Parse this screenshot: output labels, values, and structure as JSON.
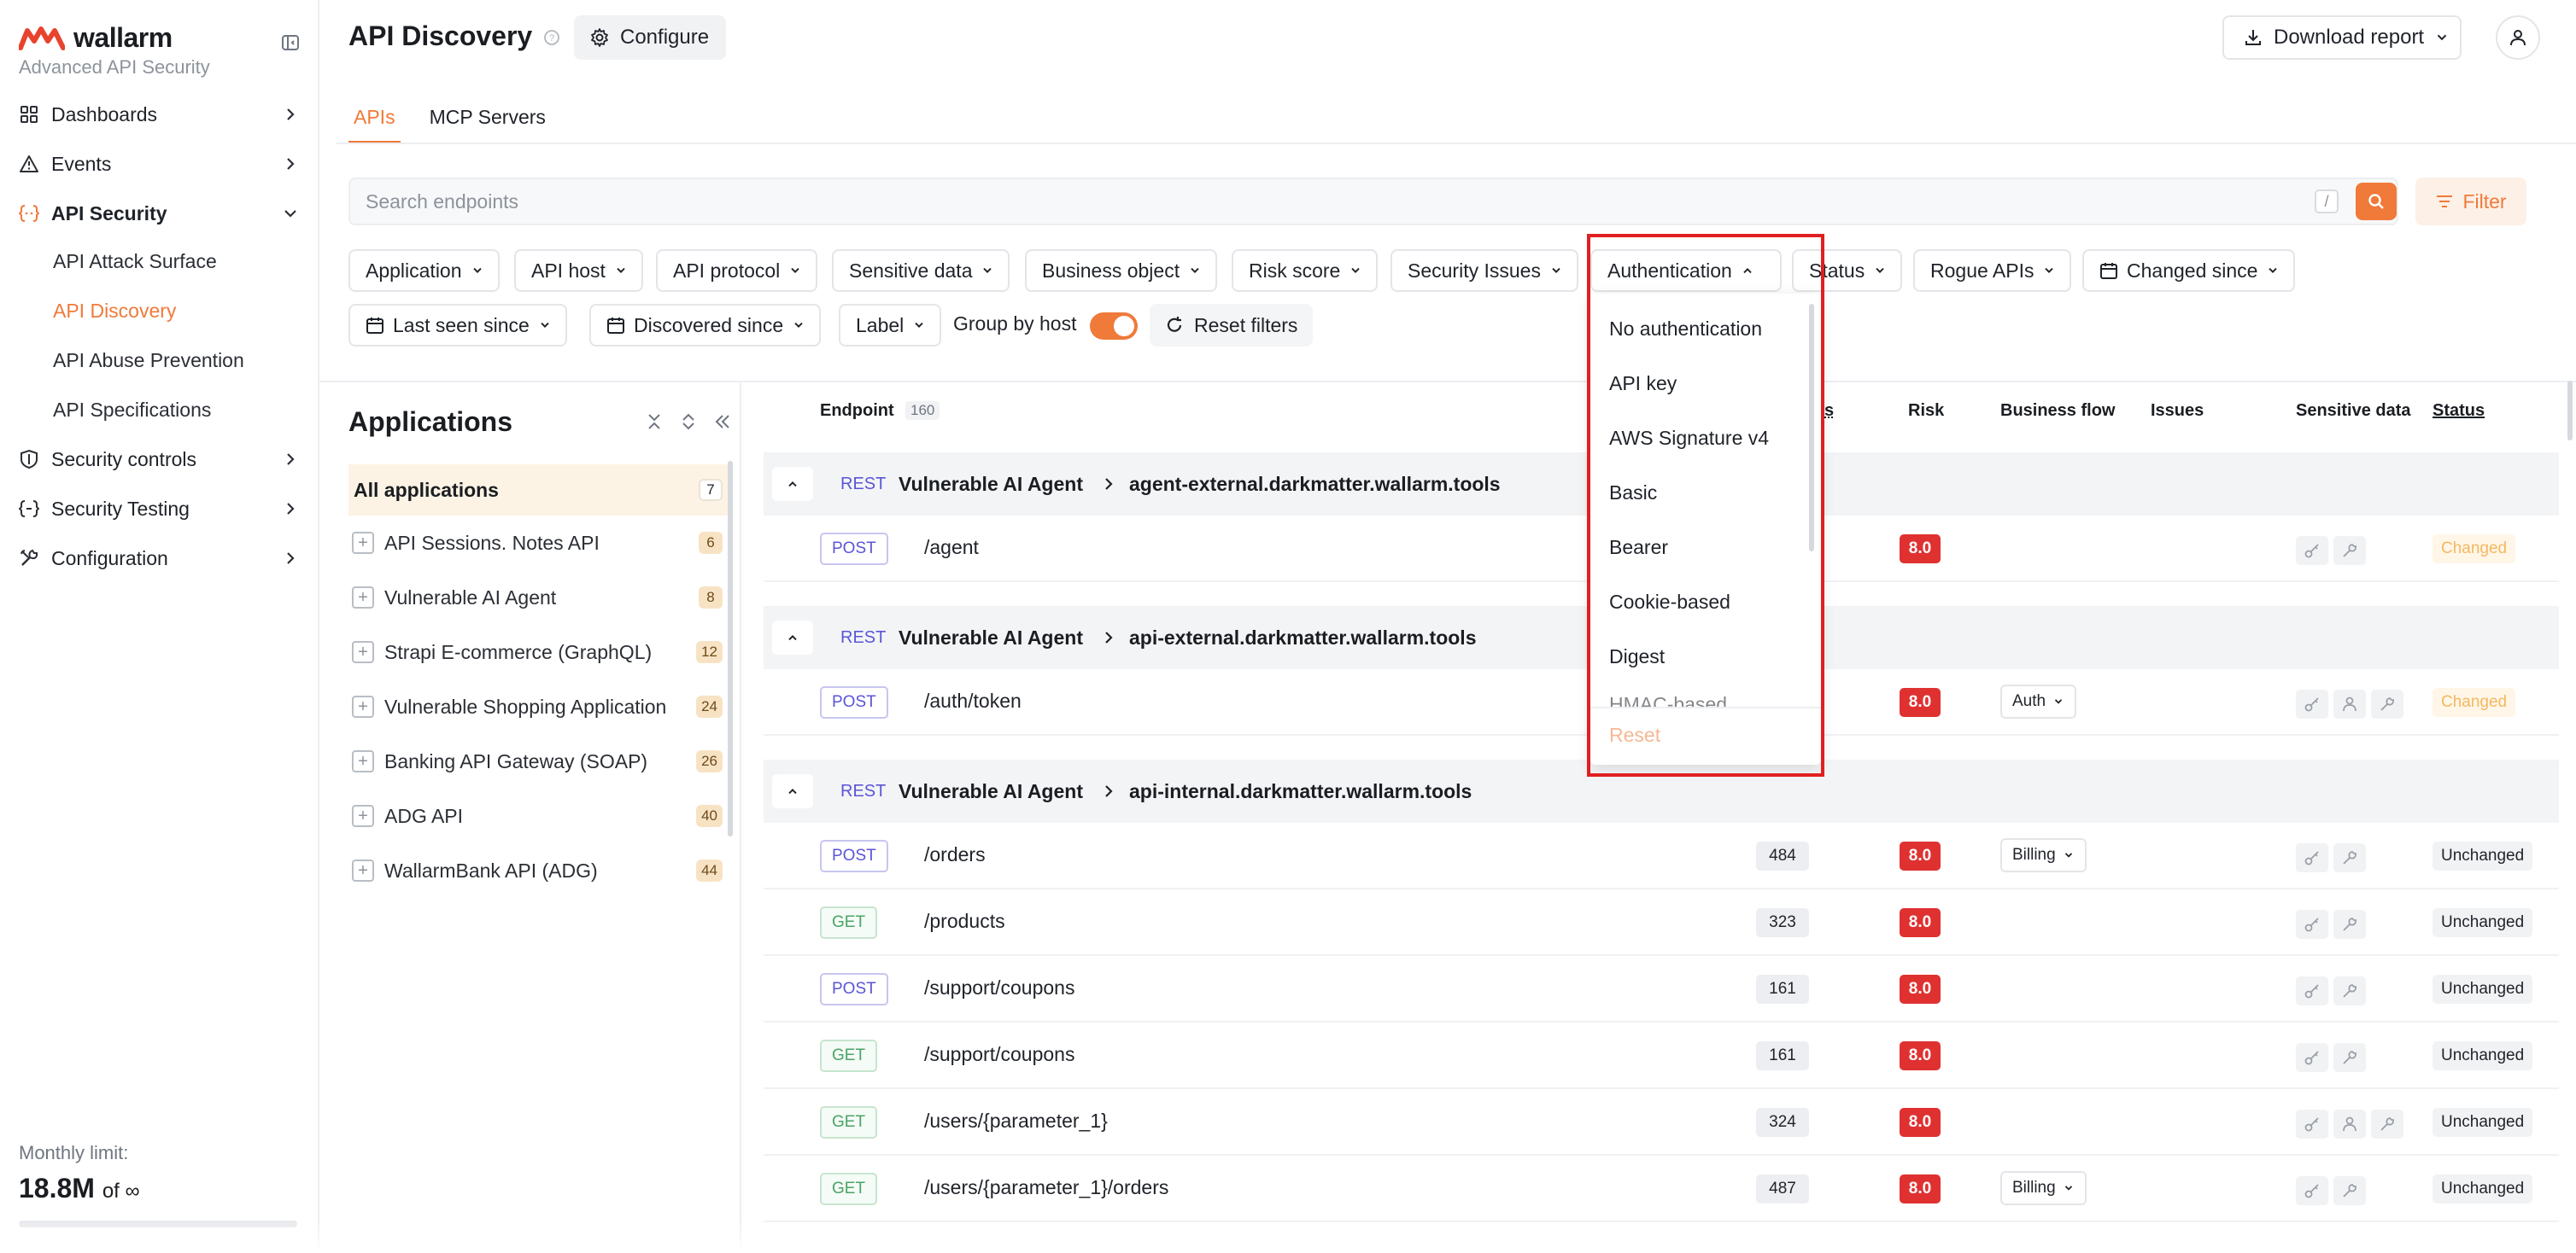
{
  "brand": {
    "name": "wallarm",
    "subtitle": "Advanced API Security",
    "accent_color": "#f07a3a"
  },
  "sidebar": {
    "items": [
      {
        "label": "Dashboards",
        "icon": "grid-icon"
      },
      {
        "label": "Events",
        "icon": "warning-icon"
      },
      {
        "label": "API Security",
        "icon": "api-brackets-icon"
      },
      {
        "label": "Security controls",
        "icon": "shield-icon"
      },
      {
        "label": "Security Testing",
        "icon": "code-brackets-icon"
      },
      {
        "label": "Configuration",
        "icon": "tools-icon"
      }
    ],
    "subitems": [
      {
        "label": "API Attack Surface"
      },
      {
        "label": "API Discovery"
      },
      {
        "label": "API Abuse Prevention"
      },
      {
        "label": "API Specifications"
      }
    ],
    "limit": {
      "label": "Monthly limit:",
      "value": "18.8M",
      "of": "of ∞"
    }
  },
  "header": {
    "title": "API Discovery",
    "configure_label": "Configure",
    "download_label": "Download report"
  },
  "tabs": [
    {
      "label": "APIs"
    },
    {
      "label": "MCP Servers"
    }
  ],
  "search": {
    "placeholder": "Search endpoints",
    "shortcut": "/",
    "filter_label": "Filter"
  },
  "filters": {
    "application": "Application",
    "api_host": "API host",
    "api_protocol": "API protocol",
    "sensitive_data": "Sensitive data",
    "business_object": "Business object",
    "risk_score": "Risk score",
    "security_issues": "Security Issues",
    "authentication": "Authentication",
    "status": "Status",
    "rogue_apis": "Rogue APIs",
    "changed_since": "Changed since",
    "last_seen_since": "Last seen since",
    "discovered_since": "Discovered since",
    "label": "Label",
    "group_by_host": "Group by host",
    "reset_filters": "Reset filters"
  },
  "auth_dropdown": {
    "options": [
      "No authentication",
      "API key",
      "AWS Signature v4",
      "Basic",
      "Bearer",
      "Cookie-based",
      "Digest",
      "HMAC-based"
    ],
    "reset_label": "Reset"
  },
  "applications": {
    "title": "Applications",
    "all_label": "All applications",
    "all_count": "7",
    "items": [
      {
        "name": "API Sessions. Notes API",
        "count": "6"
      },
      {
        "name": "Vulnerable AI Agent",
        "count": "8"
      },
      {
        "name": "Strapi E-commerce (GraphQL)",
        "count": "12"
      },
      {
        "name": "Vulnerable Shopping Application",
        "count": "24"
      },
      {
        "name": "Banking API Gateway (SOAP)",
        "count": "26"
      },
      {
        "name": "ADG API",
        "count": "40"
      },
      {
        "name": "WallarmBank API (ADG)",
        "count": "44"
      }
    ]
  },
  "table": {
    "headers": {
      "endpoint": "Endpoint",
      "endpoint_count": "160",
      "hits": "s",
      "risk": "Risk",
      "business_flow": "Business flow",
      "issues": "Issues",
      "sensitive_data": "Sensitive data",
      "status": "Status"
    },
    "groups": [
      {
        "protocol": "REST",
        "app": "Vulnerable AI Agent",
        "host": "agent-external.darkmatter.wallarm.tools",
        "rows": [
          {
            "method": "POST",
            "path": "/agent",
            "hits": "",
            "risk": "8.0",
            "flow": "",
            "status": "Changed"
          }
        ]
      },
      {
        "protocol": "REST",
        "app": "Vulnerable AI Agent",
        "host": "api-external.darkmatter.wallarm.tools",
        "rows": [
          {
            "method": "POST",
            "path": "/auth/token",
            "hits": "",
            "risk": "8.0",
            "flow": "Auth",
            "status": "Changed"
          }
        ]
      },
      {
        "protocol": "REST",
        "app": "Vulnerable AI Agent",
        "host": "api-internal.darkmatter.wallarm.tools",
        "rows": [
          {
            "method": "POST",
            "path": "/orders",
            "hits": "484",
            "risk": "8.0",
            "flow": "Billing",
            "status": "Unchanged"
          },
          {
            "method": "GET",
            "path": "/products",
            "hits": "323",
            "risk": "8.0",
            "flow": "",
            "status": "Unchanged"
          },
          {
            "method": "POST",
            "path": "/support/coupons",
            "hits": "161",
            "risk": "8.0",
            "flow": "",
            "status": "Unchanged"
          },
          {
            "method": "GET",
            "path": "/support/coupons",
            "hits": "161",
            "risk": "8.0",
            "flow": "",
            "status": "Unchanged"
          },
          {
            "method": "GET",
            "path": "/users/{parameter_1}",
            "hits": "324",
            "risk": "8.0",
            "flow": "",
            "status": "Unchanged"
          },
          {
            "method": "GET",
            "path": "/users/{parameter_1}/orders",
            "hits": "487",
            "risk": "8.0",
            "flow": "Billing",
            "status": "Unchanged"
          }
        ]
      }
    ]
  }
}
